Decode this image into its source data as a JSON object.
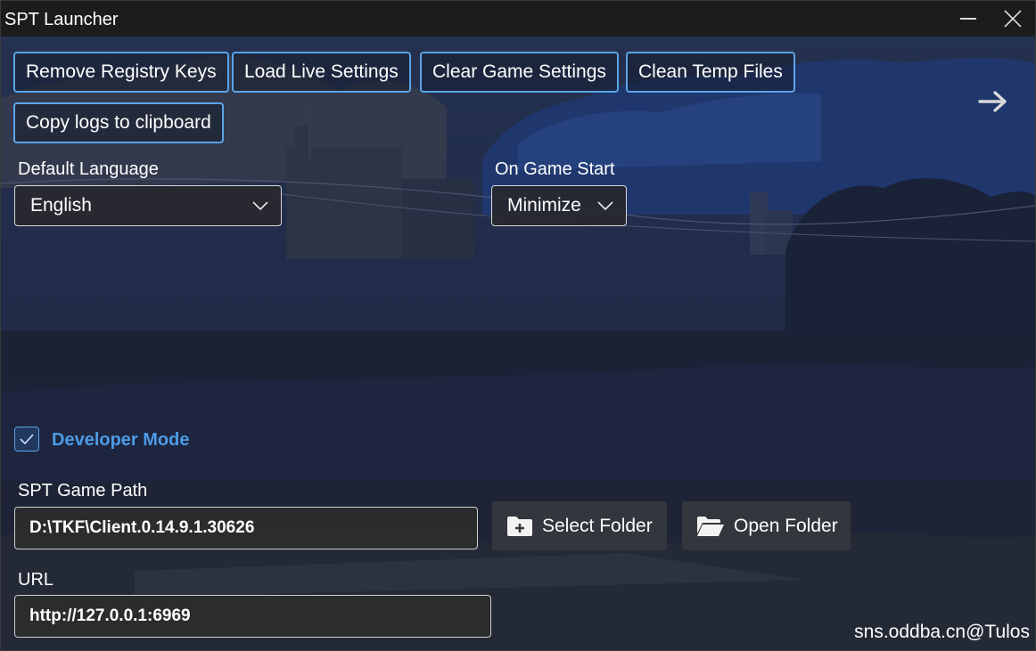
{
  "window": {
    "title": "SPT Launcher",
    "minimize_icon": "minimize-icon",
    "close_icon": "close-icon"
  },
  "toolbar": {
    "remove_registry_keys": "Remove Registry Keys",
    "load_live_settings": "Load Live Settings",
    "clear_game_settings": "Clear Game Settings",
    "clean_temp_files": "Clean Temp Files",
    "copy_logs": "Copy logs to clipboard",
    "next_icon": "arrow-right-icon"
  },
  "settings": {
    "default_language_label": "Default Language",
    "default_language_value": "English",
    "on_game_start_label": "On Game Start",
    "on_game_start_value": "Minimize",
    "developer_mode_label": "Developer Mode",
    "developer_mode_checked": true,
    "game_path_label": "SPT Game Path",
    "game_path_value": "D:\\TKF\\Client.0.14.9.1.30626",
    "select_folder": "Select Folder",
    "open_folder": "Open Folder",
    "url_label": "URL",
    "url_value": "http://127.0.0.1:6969"
  },
  "watermark": "sns.oddba.cn@Tulos",
  "colors": {
    "accent": "#5aa5e8",
    "developer_mode_text": "#4d9be6",
    "titlebar": "#1c1c1c"
  }
}
